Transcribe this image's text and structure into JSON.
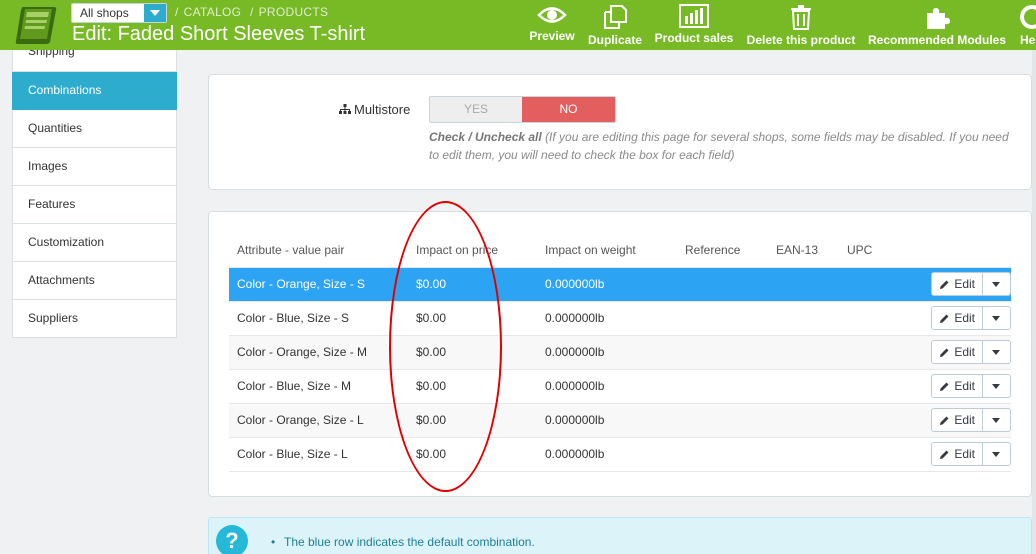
{
  "header": {
    "shop_select": "All shops",
    "breadcrumb": [
      "CATALOG",
      "PRODUCTS"
    ],
    "title": "Edit: Faded Short Sleeves T-shirt",
    "toolbar": [
      {
        "label": "Preview",
        "icon": "eye-icon"
      },
      {
        "label": "Duplicate",
        "icon": "copy-icon"
      },
      {
        "label": "Product sales",
        "icon": "bar-chart-icon"
      },
      {
        "label": "Delete this product",
        "icon": "trash-icon"
      },
      {
        "label": "Recommended Modules",
        "icon": "puzzle-icon"
      },
      {
        "label": "He",
        "icon": "help-lifebuoy-icon"
      }
    ]
  },
  "sidebar": {
    "items": [
      "Shipping",
      "Combinations",
      "Quantities",
      "Images",
      "Features",
      "Customization",
      "Attachments",
      "Suppliers"
    ],
    "active": "Combinations"
  },
  "multistore": {
    "label": "Multistore",
    "yes": "YES",
    "no": "NO",
    "help_bold": "Check / Uncheck all",
    "help_text": "(If you are editing this page for several shops, some fields may be disabled. If you need to edit them, you will need to check the box for each field)"
  },
  "combinations": {
    "columns": [
      "Attribute - value pair",
      "Impact on price",
      "Impact on weight",
      "Reference",
      "EAN-13",
      "UPC"
    ],
    "rows": [
      {
        "attribute": "Color - Orange, Size - S",
        "price": "$0.00",
        "weight": "0.000000lb",
        "reference": "",
        "ean13": "",
        "upc": "",
        "default": true
      },
      {
        "attribute": "Color - Blue, Size - S",
        "price": "$0.00",
        "weight": "0.000000lb",
        "reference": "",
        "ean13": "",
        "upc": "",
        "default": false
      },
      {
        "attribute": "Color - Orange, Size - M",
        "price": "$0.00",
        "weight": "0.000000lb",
        "reference": "",
        "ean13": "",
        "upc": "",
        "default": false
      },
      {
        "attribute": "Color - Blue, Size - M",
        "price": "$0.00",
        "weight": "0.000000lb",
        "reference": "",
        "ean13": "",
        "upc": "",
        "default": false
      },
      {
        "attribute": "Color - Orange, Size - L",
        "price": "$0.00",
        "weight": "0.000000lb",
        "reference": "",
        "ean13": "",
        "upc": "",
        "default": false
      },
      {
        "attribute": "Color - Blue, Size - L",
        "price": "$0.00",
        "weight": "0.000000lb",
        "reference": "",
        "ean13": "",
        "upc": "",
        "default": false
      }
    ],
    "edit_label": "Edit"
  },
  "info": {
    "icon_glyph": "?",
    "text": "The blue row indicates the default combination."
  },
  "colors": {
    "header_green": "#77ba25",
    "active_blue": "#2eacce",
    "default_row_blue": "#2ca3f3",
    "no_red": "#e35f5f",
    "annotation_red": "#e00000"
  }
}
